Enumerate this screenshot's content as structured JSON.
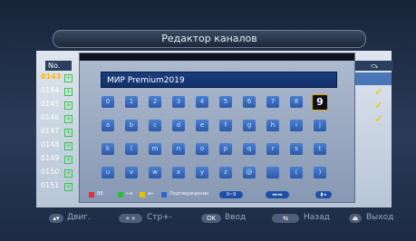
{
  "title": "Редактор каналов",
  "header": {
    "no_label": "No."
  },
  "channels": [
    {
      "num": "0143",
      "selected": true
    },
    {
      "num": "0144"
    },
    {
      "num": "0145"
    },
    {
      "num": "0146"
    },
    {
      "num": "0147"
    },
    {
      "num": "0148"
    },
    {
      "num": "0149"
    },
    {
      "num": "0150"
    },
    {
      "num": "0151"
    }
  ],
  "checkmark": "✓",
  "dialog": {
    "input_value": "МИР Premium2019",
    "keys_row1": [
      "0",
      "1",
      "2",
      "3",
      "4",
      "5",
      "6",
      "7",
      "8",
      "9"
    ],
    "keys_row2": [
      "a",
      "b",
      "c",
      "d",
      "e",
      "f",
      "g",
      "h",
      "i",
      "j"
    ],
    "keys_row3": [
      "k",
      "l",
      "m",
      "n",
      "o",
      "p",
      "q",
      "r",
      "s",
      "t"
    ],
    "keys_row4": [
      "u",
      "v",
      "w",
      "x",
      "y",
      "z",
      "@",
      "",
      "(",
      ")"
    ],
    "selected_key": "9",
    "legend": {
      "red_label": "ВВ",
      "green_label": "←a",
      "yellow_label": "a←",
      "blue_label": "Подтверждение",
      "range_label": "0~9",
      "arrows_label": "◂◂ ▸▸",
      "fwd_label": "▮ ▸"
    }
  },
  "footer": {
    "move_label": "Двиг.",
    "page_label": "Стр+-",
    "ok_key": "OK",
    "ok_label": "Ввод",
    "back_label": "Назад",
    "exit_label": "Выход"
  },
  "colors": {
    "accent": "#ffb400",
    "key": "#3a6fc4",
    "check": "#e8c300"
  }
}
